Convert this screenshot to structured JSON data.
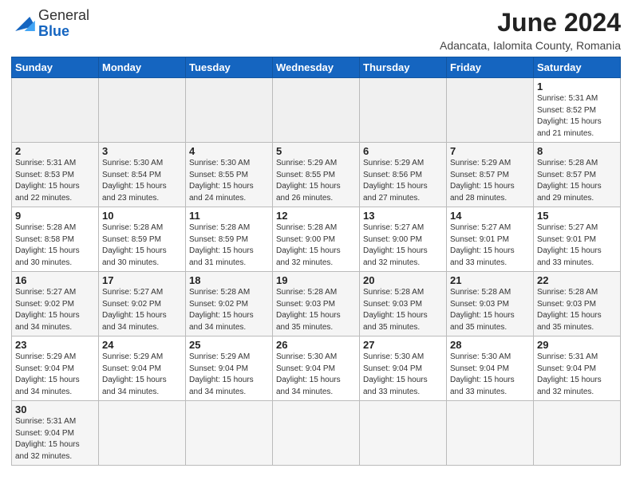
{
  "header": {
    "logo_general": "General",
    "logo_blue": "Blue",
    "title": "June 2024",
    "location": "Adancata, Ialomita County, Romania"
  },
  "weekdays": [
    "Sunday",
    "Monday",
    "Tuesday",
    "Wednesday",
    "Thursday",
    "Friday",
    "Saturday"
  ],
  "weeks": [
    [
      {
        "day": "",
        "info": ""
      },
      {
        "day": "",
        "info": ""
      },
      {
        "day": "",
        "info": ""
      },
      {
        "day": "",
        "info": ""
      },
      {
        "day": "",
        "info": ""
      },
      {
        "day": "",
        "info": ""
      },
      {
        "day": "1",
        "info": "Sunrise: 5:31 AM\nSunset: 8:52 PM\nDaylight: 15 hours\nand 21 minutes."
      }
    ],
    [
      {
        "day": "2",
        "info": "Sunrise: 5:31 AM\nSunset: 8:53 PM\nDaylight: 15 hours\nand 22 minutes."
      },
      {
        "day": "3",
        "info": "Sunrise: 5:30 AM\nSunset: 8:54 PM\nDaylight: 15 hours\nand 23 minutes."
      },
      {
        "day": "4",
        "info": "Sunrise: 5:30 AM\nSunset: 8:55 PM\nDaylight: 15 hours\nand 24 minutes."
      },
      {
        "day": "5",
        "info": "Sunrise: 5:29 AM\nSunset: 8:55 PM\nDaylight: 15 hours\nand 26 minutes."
      },
      {
        "day": "6",
        "info": "Sunrise: 5:29 AM\nSunset: 8:56 PM\nDaylight: 15 hours\nand 27 minutes."
      },
      {
        "day": "7",
        "info": "Sunrise: 5:29 AM\nSunset: 8:57 PM\nDaylight: 15 hours\nand 28 minutes."
      },
      {
        "day": "8",
        "info": "Sunrise: 5:28 AM\nSunset: 8:57 PM\nDaylight: 15 hours\nand 29 minutes."
      }
    ],
    [
      {
        "day": "9",
        "info": "Sunrise: 5:28 AM\nSunset: 8:58 PM\nDaylight: 15 hours\nand 30 minutes."
      },
      {
        "day": "10",
        "info": "Sunrise: 5:28 AM\nSunset: 8:59 PM\nDaylight: 15 hours\nand 30 minutes."
      },
      {
        "day": "11",
        "info": "Sunrise: 5:28 AM\nSunset: 8:59 PM\nDaylight: 15 hours\nand 31 minutes."
      },
      {
        "day": "12",
        "info": "Sunrise: 5:28 AM\nSunset: 9:00 PM\nDaylight: 15 hours\nand 32 minutes."
      },
      {
        "day": "13",
        "info": "Sunrise: 5:27 AM\nSunset: 9:00 PM\nDaylight: 15 hours\nand 32 minutes."
      },
      {
        "day": "14",
        "info": "Sunrise: 5:27 AM\nSunset: 9:01 PM\nDaylight: 15 hours\nand 33 minutes."
      },
      {
        "day": "15",
        "info": "Sunrise: 5:27 AM\nSunset: 9:01 PM\nDaylight: 15 hours\nand 33 minutes."
      }
    ],
    [
      {
        "day": "16",
        "info": "Sunrise: 5:27 AM\nSunset: 9:02 PM\nDaylight: 15 hours\nand 34 minutes."
      },
      {
        "day": "17",
        "info": "Sunrise: 5:27 AM\nSunset: 9:02 PM\nDaylight: 15 hours\nand 34 minutes."
      },
      {
        "day": "18",
        "info": "Sunrise: 5:28 AM\nSunset: 9:02 PM\nDaylight: 15 hours\nand 34 minutes."
      },
      {
        "day": "19",
        "info": "Sunrise: 5:28 AM\nSunset: 9:03 PM\nDaylight: 15 hours\nand 35 minutes."
      },
      {
        "day": "20",
        "info": "Sunrise: 5:28 AM\nSunset: 9:03 PM\nDaylight: 15 hours\nand 35 minutes."
      },
      {
        "day": "21",
        "info": "Sunrise: 5:28 AM\nSunset: 9:03 PM\nDaylight: 15 hours\nand 35 minutes."
      },
      {
        "day": "22",
        "info": "Sunrise: 5:28 AM\nSunset: 9:03 PM\nDaylight: 15 hours\nand 35 minutes."
      }
    ],
    [
      {
        "day": "23",
        "info": "Sunrise: 5:29 AM\nSunset: 9:04 PM\nDaylight: 15 hours\nand 34 minutes."
      },
      {
        "day": "24",
        "info": "Sunrise: 5:29 AM\nSunset: 9:04 PM\nDaylight: 15 hours\nand 34 minutes."
      },
      {
        "day": "25",
        "info": "Sunrise: 5:29 AM\nSunset: 9:04 PM\nDaylight: 15 hours\nand 34 minutes."
      },
      {
        "day": "26",
        "info": "Sunrise: 5:30 AM\nSunset: 9:04 PM\nDaylight: 15 hours\nand 34 minutes."
      },
      {
        "day": "27",
        "info": "Sunrise: 5:30 AM\nSunset: 9:04 PM\nDaylight: 15 hours\nand 33 minutes."
      },
      {
        "day": "28",
        "info": "Sunrise: 5:30 AM\nSunset: 9:04 PM\nDaylight: 15 hours\nand 33 minutes."
      },
      {
        "day": "29",
        "info": "Sunrise: 5:31 AM\nSunset: 9:04 PM\nDaylight: 15 hours\nand 32 minutes."
      }
    ],
    [
      {
        "day": "30",
        "info": "Sunrise: 5:31 AM\nSunset: 9:04 PM\nDaylight: 15 hours\nand 32 minutes."
      },
      {
        "day": "",
        "info": ""
      },
      {
        "day": "",
        "info": ""
      },
      {
        "day": "",
        "info": ""
      },
      {
        "day": "",
        "info": ""
      },
      {
        "day": "",
        "info": ""
      },
      {
        "day": "",
        "info": ""
      }
    ]
  ]
}
